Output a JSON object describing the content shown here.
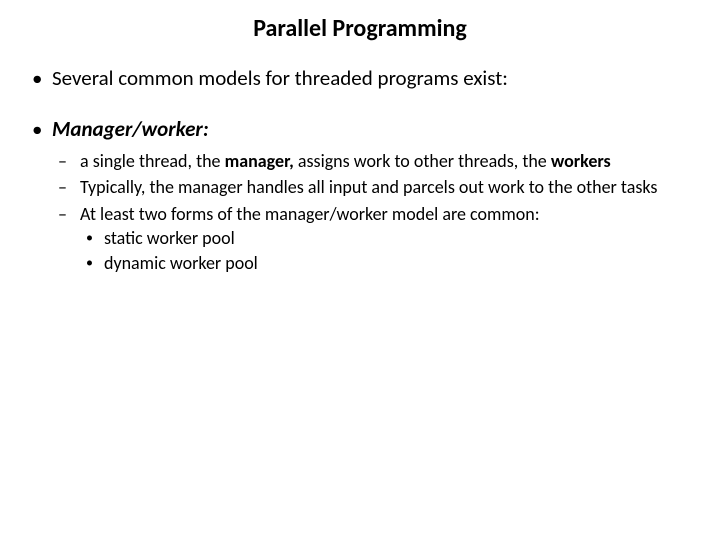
{
  "title": "Parallel Programming",
  "bullets": {
    "b1": "Several common models for threaded programs exist:",
    "b2": "Manager/worker:",
    "b2_sub": {
      "s1_pre": "a single thread, the ",
      "s1_manager": "manager,",
      "s1_mid": " assigns work to other threads, the ",
      "s1_workers": "workers",
      "s2": "Typically, the manager handles all input and parcels out work to the other tasks",
      "s3": "At least two forms of the manager/worker model are common:",
      "s3_sub": {
        "p1": "static worker pool",
        "p2": "dynamic worker pool"
      }
    }
  }
}
